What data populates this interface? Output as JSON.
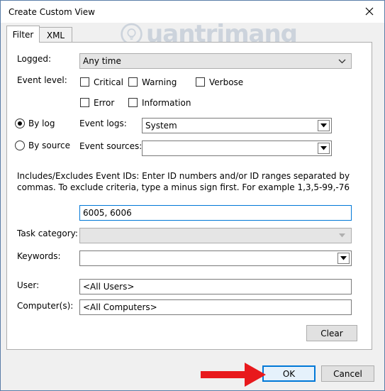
{
  "window": {
    "title": "Create Custom View"
  },
  "watermark": {
    "text": "uantrimang"
  },
  "tabs": [
    {
      "label": "Filter"
    },
    {
      "label": "XML"
    }
  ],
  "filter": {
    "logged": {
      "label": "Logged:",
      "value": "Any time"
    },
    "event_level": {
      "label": "Event level:",
      "critical": "Critical",
      "warning": "Warning",
      "verbose": "Verbose",
      "error": "Error",
      "information": "Information"
    },
    "by_log": {
      "label": "By log",
      "selected": true
    },
    "by_source": {
      "label": "By source",
      "selected": false
    },
    "event_logs": {
      "label": "Event logs:",
      "value": "System"
    },
    "event_sources": {
      "label": "Event sources:",
      "value": ""
    },
    "description": "Includes/Excludes Event IDs: Enter ID numbers and/or ID ranges separated by commas. To exclude criteria, type a minus sign first. For example 1,3,5-99,-76",
    "event_ids": {
      "value": "6005, 6006"
    },
    "task_category": {
      "label": "Task category:",
      "value": ""
    },
    "keywords": {
      "label": "Keywords:",
      "value": ""
    },
    "user": {
      "label": "User:",
      "value": "<All Users>"
    },
    "computers": {
      "label": "Computer(s):",
      "value": "<All Computers>"
    },
    "clear_button": "Clear"
  },
  "footer": {
    "ok_button": "OK",
    "cancel_button": "Cancel"
  },
  "colors": {
    "annotation_red": "#e8191c",
    "focus_blue": "#0078d7"
  },
  "icons": [
    "close-icon",
    "chevron-down-icon",
    "red-arrow-annotation"
  ]
}
